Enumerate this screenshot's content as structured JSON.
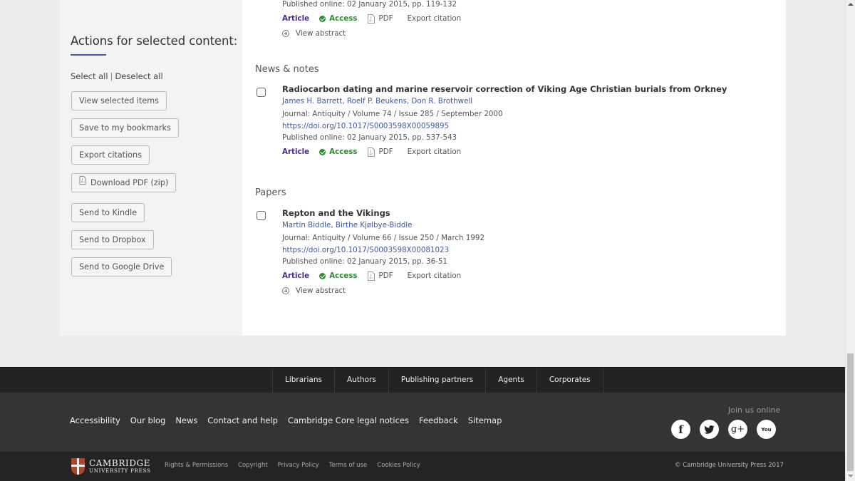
{
  "sidebar": {
    "title": "Actions for selected content:",
    "select_all": "Select all",
    "separator": "|",
    "deselect_all": "Deselect all",
    "buttons": [
      {
        "label": "View selected items"
      },
      {
        "label": "Save to my bookmarks"
      },
      {
        "label": "Export citations"
      },
      {
        "label": "Download PDF (zip)",
        "icon": "pdf-icon"
      },
      {
        "label": "Send to Kindle"
      },
      {
        "label": "Send to Dropbox"
      },
      {
        "label": "Send to Google Drive"
      }
    ]
  },
  "top_partial_entry": {
    "published": "Published online: 02 January 2015, pp. 119-132",
    "type": "Article",
    "access": "Access",
    "pdf": "PDF",
    "export": "Export citation",
    "view_abstract": "View abstract"
  },
  "sections": [
    {
      "title": "News & notes",
      "entries": [
        {
          "title": "Radiocarbon dating and marine reservoir correction of Viking Age Christian burials from Orkney",
          "authors": [
            "James H. Barrett",
            "Roelf P. Beukens",
            "Don R. Brothwell"
          ],
          "journal": "Journal: Antiquity / Volume 74 / Issue 285 / September 2000",
          "doi": "https://doi.org/10.1017/S0003598X00059895",
          "published": "Published online: 02 January 2015, pp. 537-543",
          "type": "Article",
          "access": "Access",
          "pdf": "PDF",
          "export": "Export citation"
        }
      ]
    },
    {
      "title": "Papers",
      "entries": [
        {
          "title": "Repton and the Vikings",
          "authors": [
            "Martin Biddle",
            "Birthe Kjølbye-Biddle"
          ],
          "journal": "Journal: Antiquity / Volume 66 / Issue 250 / March 1992",
          "doi": "https://doi.org/10.1017/S0003598X00081023",
          "published": "Published online: 02 January 2015, pp. 36-51",
          "type": "Article",
          "access": "Access",
          "pdf": "PDF",
          "export": "Export citation",
          "view_abstract": "View abstract"
        }
      ]
    }
  ],
  "footer": {
    "nav": [
      "Librarians",
      "Authors",
      "Publishing partners",
      "Agents",
      "Corporates"
    ],
    "links": [
      "Accessibility",
      "Our blog",
      "News",
      "Contact and help",
      "Cambridge Core legal notices",
      "Feedback",
      "Sitemap"
    ],
    "join_label": "Join us online",
    "socials": [
      {
        "name": "facebook",
        "glyph": "f"
      },
      {
        "name": "twitter",
        "glyph": "t"
      },
      {
        "name": "google-plus",
        "glyph": "g+"
      },
      {
        "name": "youtube",
        "glyph": "You"
      }
    ],
    "logo": {
      "line1": "CAMBRIDGE",
      "line2": "UNIVERSITY PRESS"
    },
    "legal": [
      "Rights & Permissions",
      "Copyright",
      "Privacy Policy",
      "Terms of use",
      "Cookies Policy"
    ],
    "copyright": "© Cambridge University Press 2017"
  },
  "colors": {
    "link_blue": "#3c5aa6",
    "article_purple": "#4b2a8f",
    "access_green": "#2e8b2e"
  }
}
